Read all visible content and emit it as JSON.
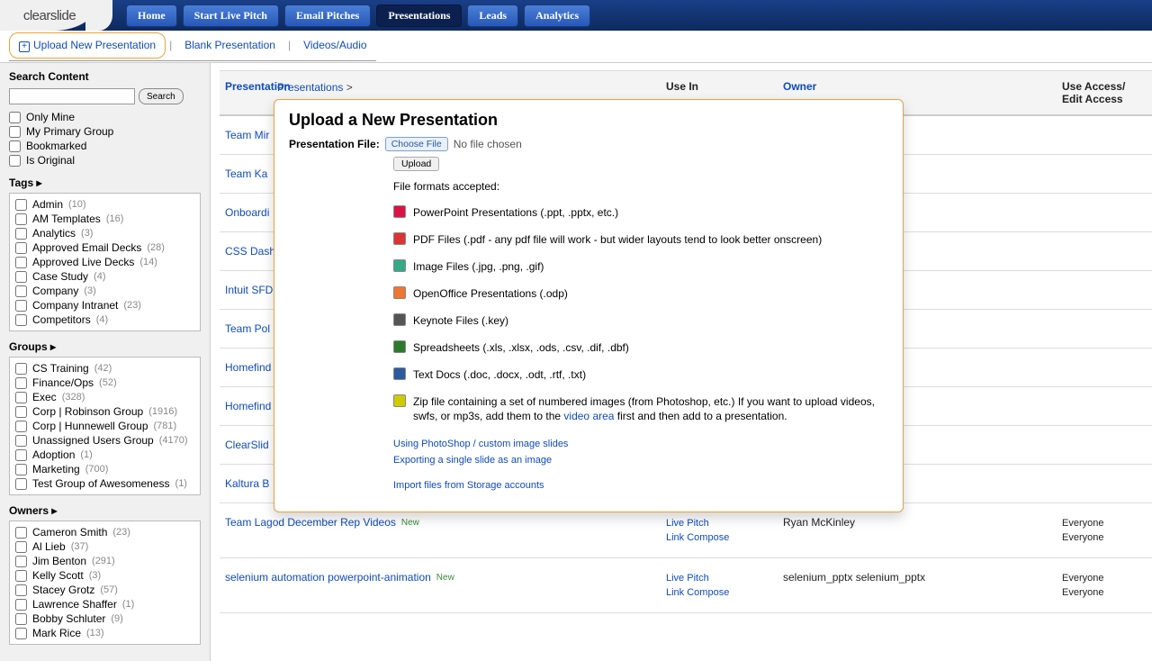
{
  "brand": "clearslide",
  "nav": [
    {
      "label": "Home",
      "active": false
    },
    {
      "label": "Start Live Pitch",
      "active": false
    },
    {
      "label": "Email Pitches",
      "active": false
    },
    {
      "label": "Presentations",
      "active": true
    },
    {
      "label": "Leads",
      "active": false
    },
    {
      "label": "Analytics",
      "active": false
    }
  ],
  "subnav": {
    "upload": "Upload New Presentation",
    "blank": "Blank Presentation",
    "videos": "Videos/Audio"
  },
  "sidebar": {
    "search_title": "Search Content",
    "search_btn": "Search",
    "filters": [
      "Only Mine",
      "My Primary Group",
      "Bookmarked",
      "Is Original"
    ],
    "tags_title": "Tags ▸",
    "tags": [
      {
        "n": "Admin",
        "c": "(10)"
      },
      {
        "n": "AM Templates",
        "c": "(16)"
      },
      {
        "n": "Analytics",
        "c": "(3)"
      },
      {
        "n": "Approved Email Decks",
        "c": "(28)"
      },
      {
        "n": "Approved Live Decks",
        "c": "(14)"
      },
      {
        "n": "Case Study",
        "c": "(4)"
      },
      {
        "n": "Company",
        "c": "(3)"
      },
      {
        "n": "Company Intranet",
        "c": "(23)"
      },
      {
        "n": "Competitors",
        "c": "(4)"
      }
    ],
    "groups_title": "Groups ▸",
    "groups": [
      {
        "n": "CS Training",
        "c": "(42)"
      },
      {
        "n": "Finance/Ops",
        "c": "(52)"
      },
      {
        "n": "Exec",
        "c": "(328)"
      },
      {
        "n": "Corp | Robinson Group",
        "c": "(1916)"
      },
      {
        "n": "Corp | Hunnewell Group",
        "c": "(781)"
      },
      {
        "n": "Unassigned Users Group",
        "c": "(4170)"
      },
      {
        "n": "Adoption",
        "c": "(1)"
      },
      {
        "n": "Marketing",
        "c": "(700)"
      },
      {
        "n": "Test Group of Awesomeness",
        "c": "(1)"
      }
    ],
    "owners_title": "Owners ▸",
    "owners": [
      {
        "n": "Cameron Smith",
        "c": "(23)"
      },
      {
        "n": "Al Lieb",
        "c": "(37)"
      },
      {
        "n": "Jim Benton",
        "c": "(291)"
      },
      {
        "n": "Kelly Scott",
        "c": "(3)"
      },
      {
        "n": "Stacey Grotz",
        "c": "(57)"
      },
      {
        "n": "Lawrence Shaffer",
        "c": "(1)"
      },
      {
        "n": "Bobby Schluter",
        "c": "(9)"
      },
      {
        "n": "Mark Rice",
        "c": "(13)"
      }
    ]
  },
  "table": {
    "headers": {
      "pres": "Presentation",
      "use": "Use In",
      "owner": "Owner",
      "access": "Use Access/\nEdit Access"
    },
    "rows": [
      {
        "pres": "Team Mir",
        "use": "",
        "owner": "",
        "access": ""
      },
      {
        "pres": "Team Ka",
        "use": "",
        "owner": "",
        "access": ""
      },
      {
        "pres": "Onboardi",
        "use": "",
        "owner": "",
        "access": ""
      },
      {
        "pres": "CSS Dash",
        "use": "",
        "owner": "",
        "access": ""
      },
      {
        "pres": "Intuit SFD",
        "use": "",
        "owner": "",
        "access": ""
      },
      {
        "pres": "Team Pol",
        "use": "",
        "owner": "",
        "access": ""
      },
      {
        "pres": "Homefind",
        "use": "",
        "owner": "",
        "access": ""
      },
      {
        "pres": "Homefind",
        "use": "",
        "owner": "",
        "access": ""
      },
      {
        "pres": "ClearSlid",
        "use": "",
        "owner": "",
        "access": ""
      },
      {
        "pres": "Kaltura B",
        "use": "",
        "owner": "",
        "access": ""
      },
      {
        "pres": "Team Lagod December Rep Videos",
        "new": "New",
        "use": "Live Pitch\nLink Compose",
        "owner": "Ryan McKinley",
        "access": "Everyone\nEveryone"
      },
      {
        "pres": "selenium automation powerpoint-animation",
        "new": "New",
        "use": "Live Pitch\nLink Compose",
        "owner": "selenium_pptx selenium_pptx",
        "access": "Everyone\nEveryone"
      }
    ]
  },
  "modal": {
    "breadcrumb": "Presentations",
    "breadcrumb_sep": ">",
    "title": "Upload a New Presentation",
    "file_label": "Presentation File:",
    "choose": "Choose File",
    "nofile": "No file chosen",
    "upload": "Upload",
    "accepted": "File formats accepted:",
    "formats": [
      {
        "cls": "fi-ppt",
        "t": "PowerPoint Presentations (.ppt, .pptx, etc.)"
      },
      {
        "cls": "fi-pdf",
        "t": "PDF Files (.pdf - any pdf file will work - but wider layouts tend to look better onscreen)"
      },
      {
        "cls": "fi-img",
        "t": "Image Files (.jpg, .png, .gif)"
      },
      {
        "cls": "fi-odp",
        "t": "OpenOffice Presentations (.odp)"
      },
      {
        "cls": "fi-key",
        "t": "Keynote Files (.key)"
      },
      {
        "cls": "fi-xls",
        "t": "Spreadsheets (.xls, .xlsx, .ods, .csv, .dif, .dbf)"
      },
      {
        "cls": "fi-doc",
        "t": "Text Docs (.doc, .docx, .odt, .rtf, .txt)"
      }
    ],
    "zip_text_1": "Zip file containing a set of numbered images (from Photoshop, etc.) If you want to upload videos, swfs, or mp3s, add them to the ",
    "zip_link": "video area",
    "zip_text_2": " first and then add to a presentation.",
    "help": [
      "Using PhotoShop / custom image slides",
      "Exporting a single slide as an image",
      "Import files from Storage accounts"
    ]
  }
}
